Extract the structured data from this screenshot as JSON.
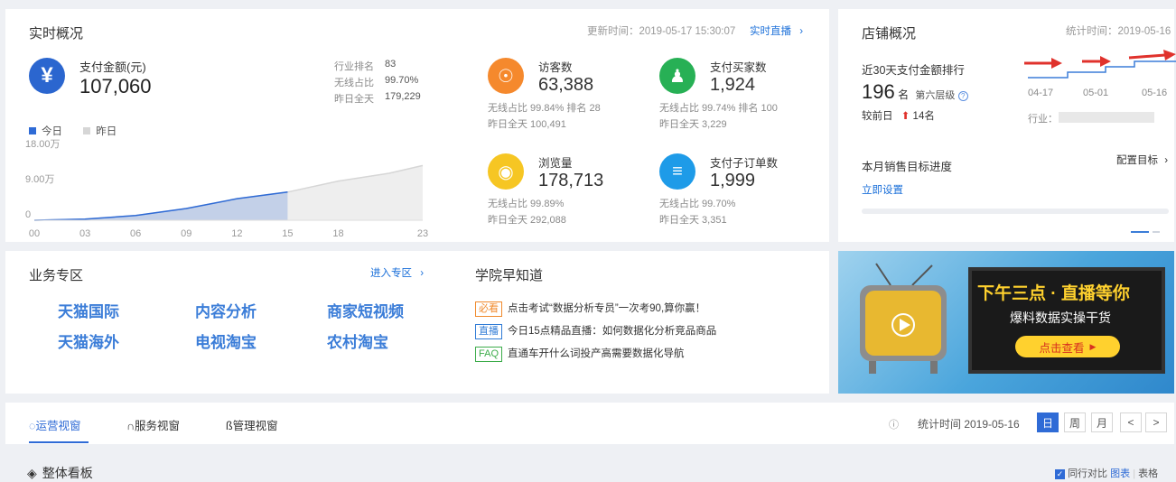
{
  "realtime": {
    "title": "实时概况",
    "update_time": "更新时间：2019-05-17 15:30:07",
    "live_link": "实时直播",
    "pay": {
      "label": "支付金额(元)",
      "value": "107,060",
      "rank_label": "行业排名",
      "rank_value": "83",
      "wireless_label": "无线占比",
      "wireless_value": "99.70%",
      "yesterday_label": "昨日全天",
      "yesterday_value": "179,229"
    },
    "legend": {
      "today": "今日",
      "yesterday": "昨日"
    },
    "metrics": [
      {
        "label": "访客数",
        "value": "63,388",
        "line1": "无线占比  99.84%  排名 28",
        "line2": "昨日全天  100,491",
        "color": "#f5892d",
        "icon": "footprint-icon"
      },
      {
        "label": "支付买家数",
        "value": "1,924",
        "line1": "无线占比  99.74%  排名 100",
        "line2": "昨日全天  3,229",
        "color": "#27b055",
        "icon": "buyer-icon"
      },
      {
        "label": "浏览量",
        "value": "178,713",
        "line1": "无线占比  99.89%",
        "line2": "昨日全天  292,088",
        "color": "#f6c623",
        "icon": "eye-icon"
      },
      {
        "label": "支付子订单数",
        "value": "1,999",
        "line1": "无线占比  99.70%",
        "line2": "昨日全天  3,351",
        "color": "#1e9be8",
        "icon": "order-icon"
      }
    ]
  },
  "chart_data": {
    "type": "area",
    "x_ticks": [
      "00",
      "03",
      "06",
      "09",
      "12",
      "15",
      "18",
      "23"
    ],
    "y_ticks": [
      "18.00万",
      "9.00万",
      "0"
    ],
    "ylim": [
      0,
      180000
    ],
    "series": [
      {
        "name": "今日",
        "color": "#2f6bd6",
        "points": [
          [
            0,
            0
          ],
          [
            3,
            3000
          ],
          [
            6,
            12000
          ],
          [
            9,
            30000
          ],
          [
            12,
            55000
          ],
          [
            15,
            72000
          ]
        ]
      },
      {
        "name": "昨日",
        "color": "#d6d6d6",
        "points": [
          [
            0,
            0
          ],
          [
            3,
            3000
          ],
          [
            6,
            12000
          ],
          [
            9,
            30000
          ],
          [
            12,
            55000
          ],
          [
            15,
            72000
          ],
          [
            18,
            100000
          ],
          [
            21,
            120000
          ],
          [
            23,
            140000
          ]
        ]
      }
    ]
  },
  "shop": {
    "title": "店铺概况",
    "stat_time": "统计时间：2019-05-16",
    "rank_title": "近30天支付金额排行",
    "rank_value": "196",
    "rank_unit": "名",
    "tier": "第六层级",
    "compare_label": "较前日",
    "compare_value": "14名",
    "dates": [
      "04-17",
      "05-01",
      "05-16"
    ],
    "industry_label": "行业：",
    "goal_title": "本月销售目标进度",
    "goal_config": "配置目标",
    "goal_set": "立即设置"
  },
  "business": {
    "title": "业务专区",
    "enter": "进入专区",
    "links": [
      "天猫国际",
      "内容分析",
      "商家短视频",
      "天猫海外",
      "电视淘宝",
      "农村淘宝"
    ]
  },
  "academy": {
    "title": "学院早知道",
    "items": [
      {
        "tag": "必看",
        "text": "点击考试“数据分析专员”一次考90,算你赢！",
        "color": "#f08a2c"
      },
      {
        "tag": "直播",
        "text": "今日15点精品直播：如何数据化分析竞品商品",
        "color": "#2f7bd6"
      },
      {
        "tag": "FAQ",
        "text": "直通车开什么词投产高需要数据化导航",
        "color": "#3cac4a"
      }
    ]
  },
  "banner": {
    "headline": "下午三点 · 直播等你",
    "sub": "爆料数据实操干货",
    "cta": "点击查看"
  },
  "tabs": {
    "items": [
      "运营视窗",
      "服务视窗",
      "管理视窗"
    ],
    "stat_time": "统计时间 2019-05-16",
    "periods": [
      "日",
      "周",
      "月"
    ],
    "prev": "<",
    "next": ">"
  },
  "board": {
    "title": "整体看板",
    "compare": "同行对比",
    "chart": "图表",
    "sep": "|",
    "table": "表格"
  }
}
